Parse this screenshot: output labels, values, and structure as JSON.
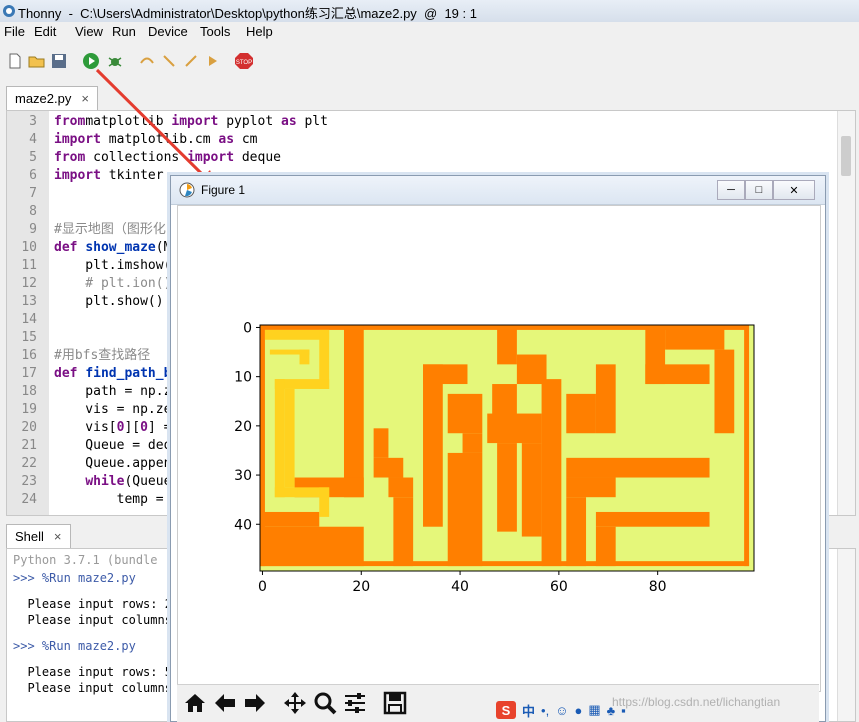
{
  "window": {
    "title": "Thonny  -  C:\\Users\\Administrator\\Desktop\\python练习汇总\\maze2.py  @  19 : 1"
  },
  "menu": [
    "File",
    "Edit",
    "View",
    "Run",
    "Device",
    "Tools",
    "Help"
  ],
  "toolbar": {
    "icons": [
      "new-file-icon",
      "open-file-icon",
      "save-icon",
      "run-icon",
      "debug-icon",
      "step-over-icon",
      "step-into-icon",
      "step-out-icon",
      "resume-icon",
      "stop-icon"
    ],
    "stop_label": "STOP"
  },
  "editor": {
    "tab_label": "maze2.py",
    "close_glyph": "×",
    "line_numbers": [
      "3",
      "4",
      "5",
      "6",
      "7",
      "8",
      "9",
      "10",
      "11",
      "12",
      "13",
      "14",
      "15",
      "16",
      "17",
      "18",
      "19",
      "20",
      "21",
      "22",
      "23",
      "24"
    ],
    "lines": [
      [
        [
          "kw",
          "from"
        ],
        [
          "",
          "matplotlib "
        ],
        [
          "kw",
          "import"
        ],
        [
          "",
          " pyplot "
        ],
        [
          "kw",
          "as"
        ],
        [
          "",
          " plt"
        ]
      ],
      [
        [
          "kw",
          "import"
        ],
        [
          "",
          " matplotlib.cm "
        ],
        [
          "kw",
          "as"
        ],
        [
          "",
          " cm"
        ]
      ],
      [
        [
          "kw",
          "from"
        ],
        [
          "",
          " collections "
        ],
        [
          "kw",
          "import"
        ],
        [
          "",
          " deque"
        ]
      ],
      [
        [
          "kw",
          "import"
        ],
        [
          "",
          " tkinter"
        ]
      ],
      [],
      [],
      [
        [
          "cm",
          "#显示地图（图形化"
        ]
      ],
      [
        [
          "kw",
          "def"
        ],
        [
          "",
          " "
        ],
        [
          "fn",
          "show_maze"
        ],
        [
          "",
          "(M"
        ]
      ],
      [
        [
          "",
          "    plt.imshow("
        ]
      ],
      [
        [
          "cm",
          "    # plt.ion()"
        ]
      ],
      [
        [
          "",
          "    plt.show()"
        ]
      ],
      [],
      [],
      [
        [
          "cm",
          "#用bfs查找路径"
        ]
      ],
      [
        [
          "kw",
          "def"
        ],
        [
          "",
          " "
        ],
        [
          "fn",
          "find_path_b"
        ]
      ],
      [
        [
          "",
          "    path = np.z"
        ]
      ],
      [
        [
          "",
          "    vis = np.ze"
        ]
      ],
      [
        [
          "",
          "    vis["
        ],
        [
          "kw",
          "0"
        ],
        [
          "",
          "]["
        ],
        [
          "kw",
          "0"
        ],
        [
          "",
          "] ="
        ]
      ],
      [
        [
          "",
          "    Queue = deq"
        ]
      ],
      [
        [
          "",
          "    Queue.appen"
        ]
      ],
      [
        [
          "",
          "    "
        ],
        [
          "kw",
          "while"
        ],
        [
          "",
          "(Queue"
        ]
      ],
      [
        [
          "",
          "        temp = "
        ]
      ]
    ]
  },
  "shell": {
    "tab_label": "Shell",
    "close_glyph": "×",
    "lines": [
      {
        "text": "Python 3.7.1 (bundle",
        "style": "gray"
      },
      {
        "text": ">>> %Run maze2.py",
        "style": "prompt"
      },
      {
        "text": "",
        "style": ""
      },
      {
        "text": "  Please input rows: 2",
        "style": ""
      },
      {
        "text": "  Please input columns",
        "style": ""
      },
      {
        "text": "",
        "style": ""
      },
      {
        "text": ">>> %Run maze2.py",
        "style": "prompt"
      },
      {
        "text": "",
        "style": ""
      },
      {
        "text": "  Please input rows: 5",
        "style": ""
      },
      {
        "text": "  Please input columns",
        "style": ""
      }
    ]
  },
  "figure": {
    "title": "Figure 1",
    "window_buttons": [
      "─",
      "□",
      "✕"
    ],
    "nav_tools": [
      "home-icon",
      "back-icon",
      "forward-icon",
      "pan-icon",
      "zoom-icon",
      "configure-subplots-icon",
      "save-figure-icon"
    ]
  },
  "taskbar_tray": {
    "ime_label": "中"
  },
  "watermark": "https://blog.csdn.net/lichangtian",
  "colors": {
    "wall": "#ff7f00",
    "open": "#e5f77a",
    "path": "#ffd21f",
    "arrow": "#e43c2f"
  },
  "chart_data": {
    "type": "heatmap",
    "title": "",
    "xlabel": "",
    "ylabel": "",
    "x_ticks": [
      0,
      20,
      40,
      60,
      80
    ],
    "y_ticks": [
      0,
      10,
      20,
      30,
      40
    ],
    "xlim": [
      0,
      100
    ],
    "ylim": [
      49,
      0
    ],
    "legend": "none",
    "grid": false,
    "rows": 50,
    "cols": 100,
    "base": "open",
    "cells": [
      {
        "v": "wall",
        "x0": 0,
        "x1": 99,
        "y0": 0,
        "y1": 1
      },
      {
        "v": "wall",
        "x0": 0,
        "x1": 99,
        "y0": 48,
        "y1": 49
      },
      {
        "v": "wall",
        "x0": 0,
        "x1": 1,
        "y0": 0,
        "y1": 49
      },
      {
        "v": "wall",
        "x0": 98,
        "x1": 99,
        "y0": 0,
        "y1": 49
      },
      {
        "v": "wall",
        "x0": 17,
        "x1": 21,
        "y0": 0,
        "y1": 35
      },
      {
        "v": "wall",
        "x0": 7,
        "x1": 21,
        "y0": 31,
        "y1": 35
      },
      {
        "v": "wall",
        "x0": 0,
        "x1": 12,
        "y0": 38,
        "y1": 41
      },
      {
        "v": "wall",
        "x0": 0,
        "x1": 21,
        "y0": 41,
        "y1": 49
      },
      {
        "v": "wall",
        "x0": 23,
        "x1": 26,
        "y0": 21,
        "y1": 27
      },
      {
        "v": "wall",
        "x0": 23,
        "x1": 29,
        "y0": 27,
        "y1": 31
      },
      {
        "v": "wall",
        "x0": 26,
        "x1": 31,
        "y0": 31,
        "y1": 35
      },
      {
        "v": "wall",
        "x0": 27,
        "x1": 31,
        "y0": 35,
        "y1": 49
      },
      {
        "v": "wall",
        "x0": 33,
        "x1": 37,
        "y0": 8,
        "y1": 41
      },
      {
        "v": "wall",
        "x0": 33,
        "x1": 42,
        "y0": 8,
        "y1": 12
      },
      {
        "v": "wall",
        "x0": 38,
        "x1": 45,
        "y0": 14,
        "y1": 22
      },
      {
        "v": "wall",
        "x0": 41,
        "x1": 45,
        "y0": 22,
        "y1": 26
      },
      {
        "v": "wall",
        "x0": 38,
        "x1": 45,
        "y0": 26,
        "y1": 49
      },
      {
        "v": "wall",
        "x0": 48,
        "x1": 52,
        "y0": 0,
        "y1": 8
      },
      {
        "v": "wall",
        "x0": 52,
        "x1": 58,
        "y0": 6,
        "y1": 12
      },
      {
        "v": "wall",
        "x0": 47,
        "x1": 52,
        "y0": 12,
        "y1": 22
      },
      {
        "v": "wall",
        "x0": 46,
        "x1": 57,
        "y0": 18,
        "y1": 24
      },
      {
        "v": "wall",
        "x0": 53,
        "x1": 57,
        "y0": 24,
        "y1": 43
      },
      {
        "v": "wall",
        "x0": 48,
        "x1": 52,
        "y0": 24,
        "y1": 42
      },
      {
        "v": "wall",
        "x0": 57,
        "x1": 61,
        "y0": 11,
        "y1": 49
      },
      {
        "v": "wall",
        "x0": 62,
        "x1": 68,
        "y0": 14,
        "y1": 22
      },
      {
        "v": "wall",
        "x0": 68,
        "x1": 72,
        "y0": 8,
        "y1": 22
      },
      {
        "v": "wall",
        "x0": 62,
        "x1": 91,
        "y0": 27,
        "y1": 31
      },
      {
        "v": "wall",
        "x0": 62,
        "x1": 72,
        "y0": 31,
        "y1": 35
      },
      {
        "v": "wall",
        "x0": 62,
        "x1": 66,
        "y0": 35,
        "y1": 49
      },
      {
        "v": "wall",
        "x0": 68,
        "x1": 91,
        "y0": 38,
        "y1": 41
      },
      {
        "v": "wall",
        "x0": 68,
        "x1": 72,
        "y0": 41,
        "y1": 49
      },
      {
        "v": "wall",
        "x0": 78,
        "x1": 82,
        "y0": 0,
        "y1": 12
      },
      {
        "v": "wall",
        "x0": 78,
        "x1": 91,
        "y0": 8,
        "y1": 12
      },
      {
        "v": "wall",
        "x0": 82,
        "x1": 94,
        "y0": 0,
        "y1": 5
      },
      {
        "v": "wall",
        "x0": 92,
        "x1": 96,
        "y0": 5,
        "y1": 22
      },
      {
        "v": "path",
        "x0": 1,
        "x1": 14,
        "y0": 1,
        "y1": 3
      },
      {
        "v": "path",
        "x0": 12,
        "x1": 14,
        "y0": 1,
        "y1": 13
      },
      {
        "v": "path",
        "x0": 2,
        "x1": 10,
        "y0": 5,
        "y1": 6
      },
      {
        "v": "path",
        "x0": 8,
        "x1": 10,
        "y0": 5,
        "y1": 8
      },
      {
        "v": "path",
        "x0": 3,
        "x1": 14,
        "y0": 11,
        "y1": 13
      },
      {
        "v": "path",
        "x0": 3,
        "x1": 5,
        "y0": 11,
        "y1": 35
      },
      {
        "v": "path",
        "x0": 5,
        "x1": 7,
        "y0": 13,
        "y1": 33
      },
      {
        "v": "path",
        "x0": 3,
        "x1": 14,
        "y0": 33,
        "y1": 35
      },
      {
        "v": "path",
        "x0": 12,
        "x1": 14,
        "y0": 33,
        "y1": 39
      }
    ]
  }
}
